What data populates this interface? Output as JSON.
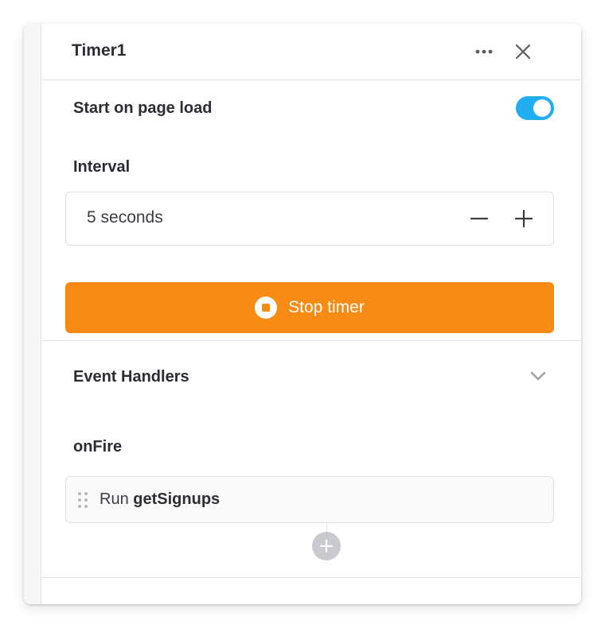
{
  "header": {
    "title": "Timer1"
  },
  "settings": {
    "start_on_load_label": "Start on page load",
    "start_on_load_enabled": true,
    "interval_label": "Interval",
    "interval_value": "5 seconds",
    "stop_button_label": "Stop timer"
  },
  "event_handlers": {
    "section_title": "Event Handlers",
    "event_name": "onFire",
    "handler": {
      "prefix": "Run",
      "target": "getSignups"
    }
  },
  "colors": {
    "toggle_on": "#20aef0",
    "stop_button": "#f78b14",
    "add_button": "#c8cacf"
  },
  "icons": [
    "more-horizontal-icon",
    "close-icon",
    "minus-icon",
    "plus-icon",
    "stop-circle-icon",
    "chevron-down-icon",
    "drag-handle-icon",
    "add-icon"
  ]
}
